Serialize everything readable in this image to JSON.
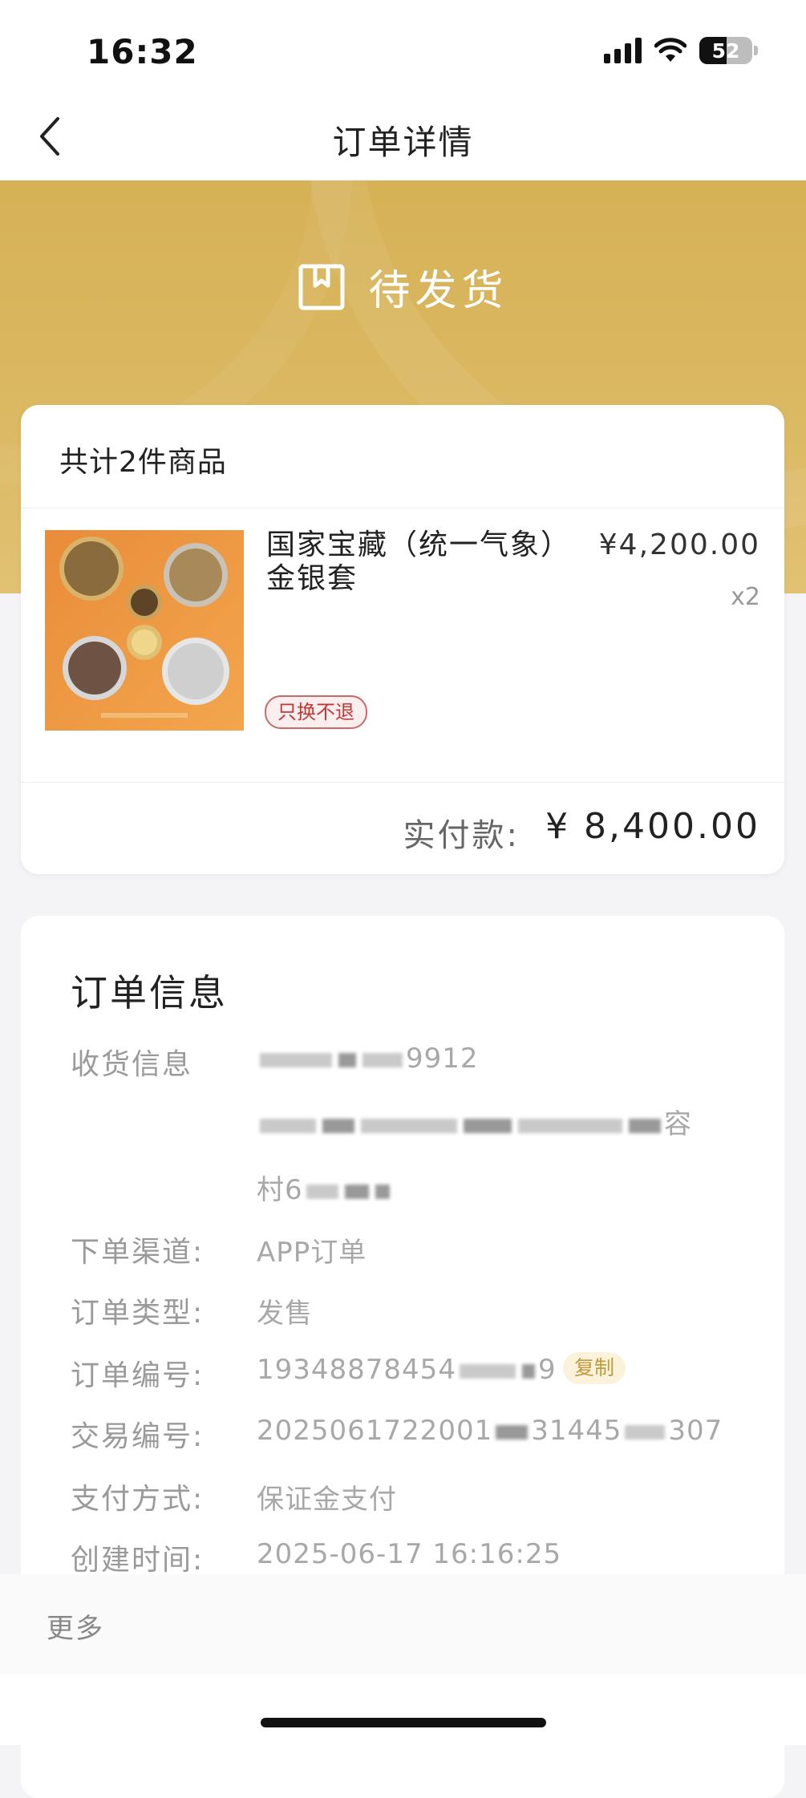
{
  "status_bar": {
    "time": "16:32",
    "battery": "52"
  },
  "nav": {
    "title": "订单详情"
  },
  "order_status": {
    "label": "待发货",
    "icon": "package-box-icon"
  },
  "product_card": {
    "count_label": "共计2件商品",
    "item": {
      "name": "国家宝藏（统一气象）金银套",
      "price": "¥4,200.00",
      "quantity": "x2",
      "tag": "只换不退",
      "image": "coin-set-image"
    },
    "paid_label": "实付款:",
    "paid_value": "¥ 8,400.00"
  },
  "order_info": {
    "title": "订单信息",
    "rows": [
      {
        "label": "收货信息",
        "value_visible": "9912"
      },
      {
        "label": "",
        "value_visible": "容"
      },
      {
        "label": "",
        "value_visible": "村6"
      },
      {
        "label": "下单渠道:",
        "value_visible": "APP订单"
      },
      {
        "label": "订单类型:",
        "value_visible": "发售"
      },
      {
        "label": "订单编号:",
        "value_visible": "19348878454",
        "value_tail": "9"
      },
      {
        "label": "交易编号:",
        "value_visible": "2025061722001",
        "value_mid": "31445",
        "value_tail": "307"
      },
      {
        "label": "支付方式:",
        "value_visible": "保证金支付"
      },
      {
        "label": "创建时间:",
        "value_visible": "2025-06-17 16:16:25"
      }
    ],
    "copy_label": "复制"
  },
  "footer": {
    "more_label": "更多"
  },
  "colors": {
    "gold": "#d6b156",
    "tag_red": "#c03838",
    "copy_gold": "#c59a3c"
  }
}
